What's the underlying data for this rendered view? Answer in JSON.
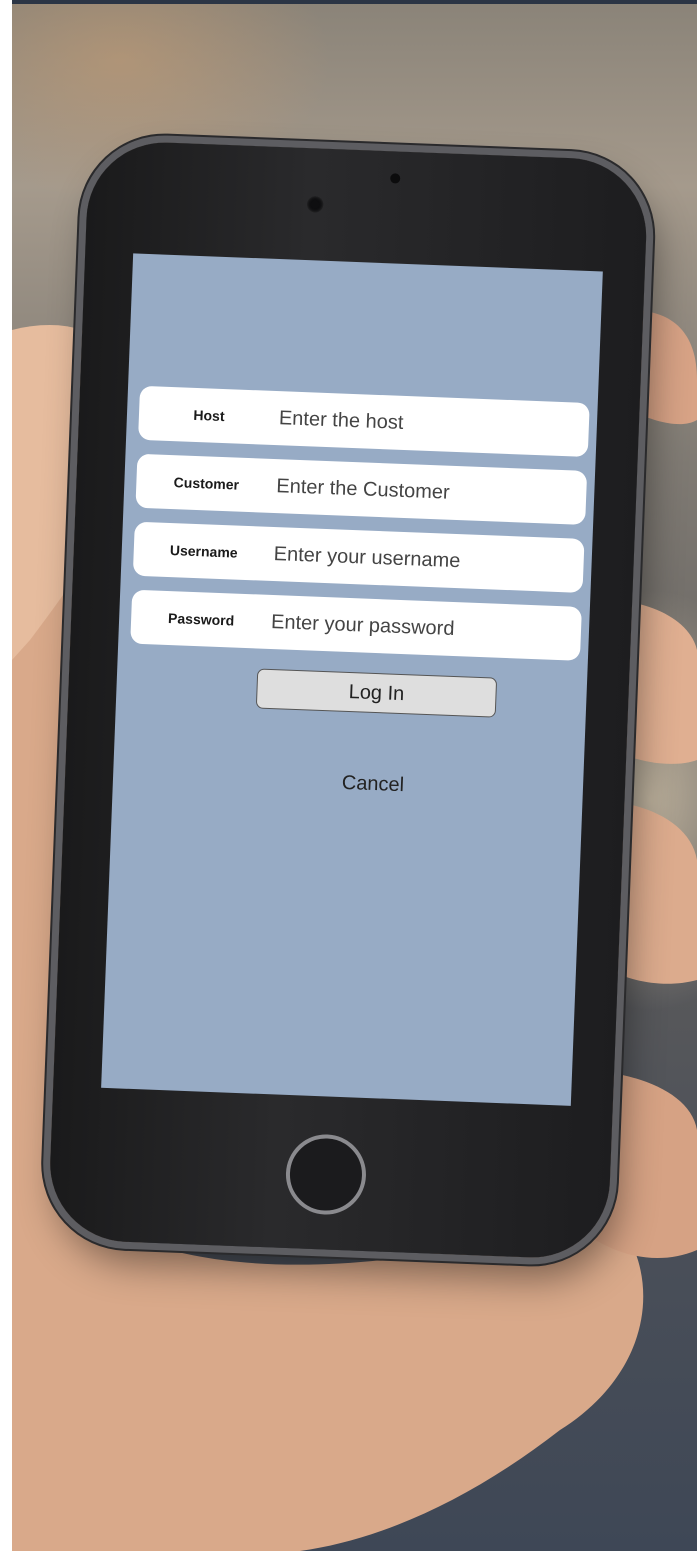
{
  "login_form": {
    "fields": [
      {
        "label": "Host",
        "placeholder": "Enter the host"
      },
      {
        "label": "Customer",
        "placeholder": "Enter the Customer"
      },
      {
        "label": "Username",
        "placeholder": "Enter your username"
      },
      {
        "label": "Password",
        "placeholder": "Enter your password"
      }
    ],
    "login_label": "Log In",
    "cancel_label": "Cancel"
  },
  "colors": {
    "screen_background": "#97abc5",
    "field_background": "#ffffff",
    "button_background": "#dedede",
    "phone_body": "#1d1d1f",
    "skin": "#e2b79a"
  }
}
